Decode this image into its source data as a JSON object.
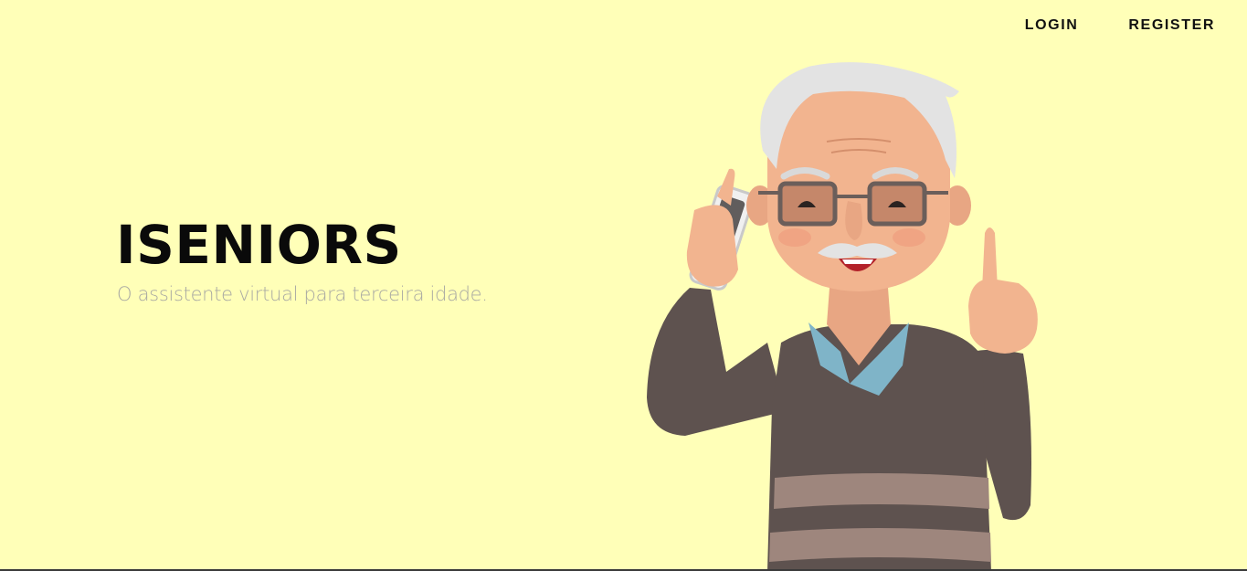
{
  "nav": {
    "login_label": "LOGIN",
    "register_label": "REGISTER"
  },
  "hero": {
    "title": "ISENIORS",
    "subtitle": "O assistente virtual para terceira idade."
  },
  "illustration": {
    "icon": "elderly-man-on-phone-illustration"
  },
  "colors": {
    "background": "#ffffb8",
    "title": "#0a0a0a",
    "subtitle": "#a9a9a3",
    "sweater": "#5e524f",
    "sweater_stripe": "#9e867d",
    "collar": "#7fb4c8",
    "skin": "#f2b48f",
    "hair": "#e3e3e3"
  }
}
